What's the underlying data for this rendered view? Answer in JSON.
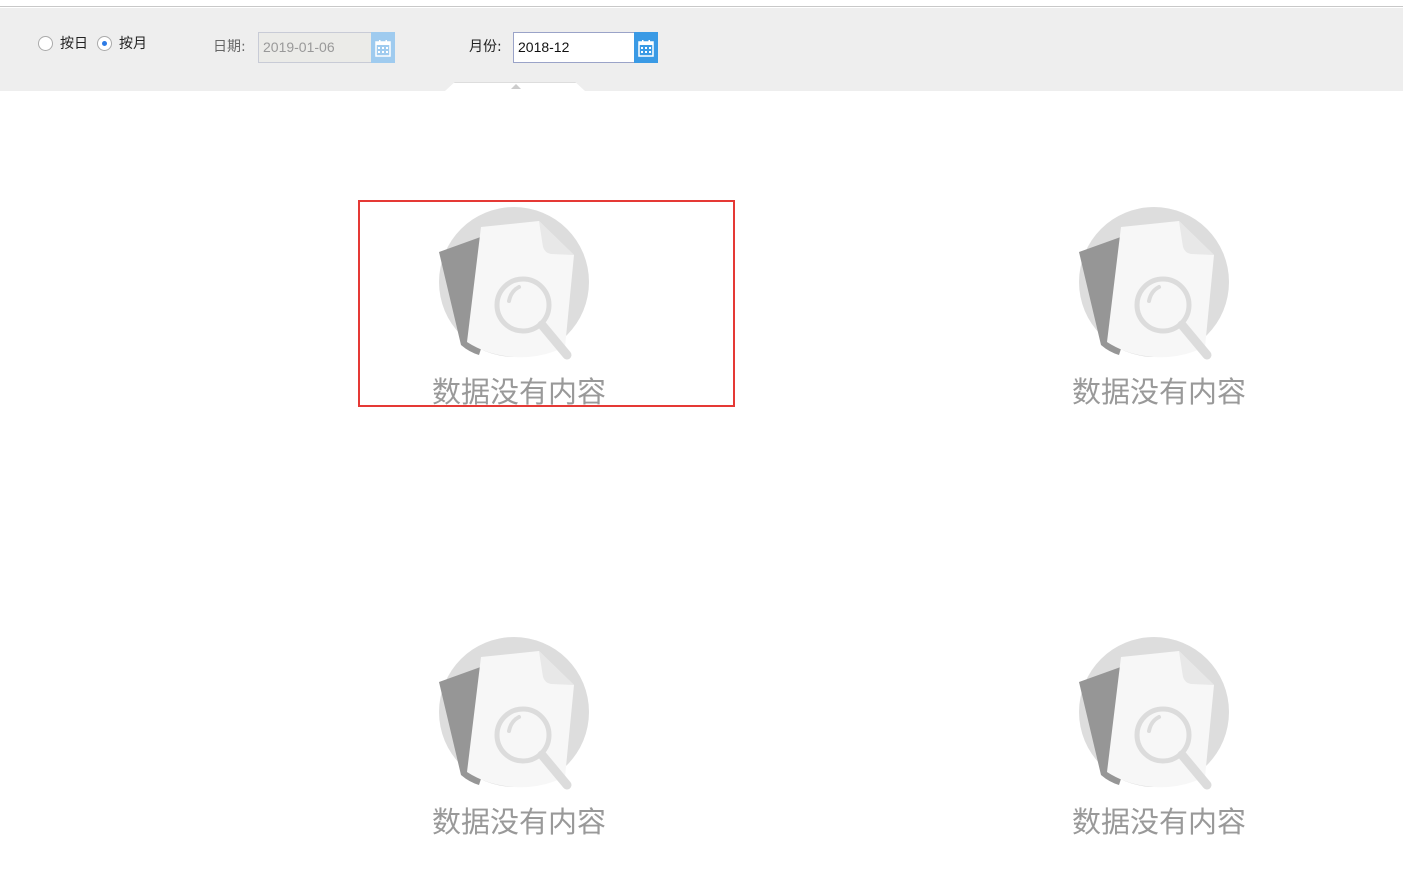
{
  "filter": {
    "mode_options": [
      {
        "label": "按日",
        "checked": false
      },
      {
        "label": "按月",
        "checked": true
      }
    ],
    "date_label": "日期:",
    "date_value": "2019-01-06",
    "month_label": "月份:",
    "month_value": "2018-12"
  },
  "panels": [
    {
      "empty_text": "数据没有内容"
    },
    {
      "empty_text": "数据没有内容"
    },
    {
      "empty_text": "数据没有内容"
    },
    {
      "empty_text": "数据没有内容"
    }
  ],
  "colors": {
    "highlight": "#e53935",
    "accent": "#3a9ae5"
  }
}
